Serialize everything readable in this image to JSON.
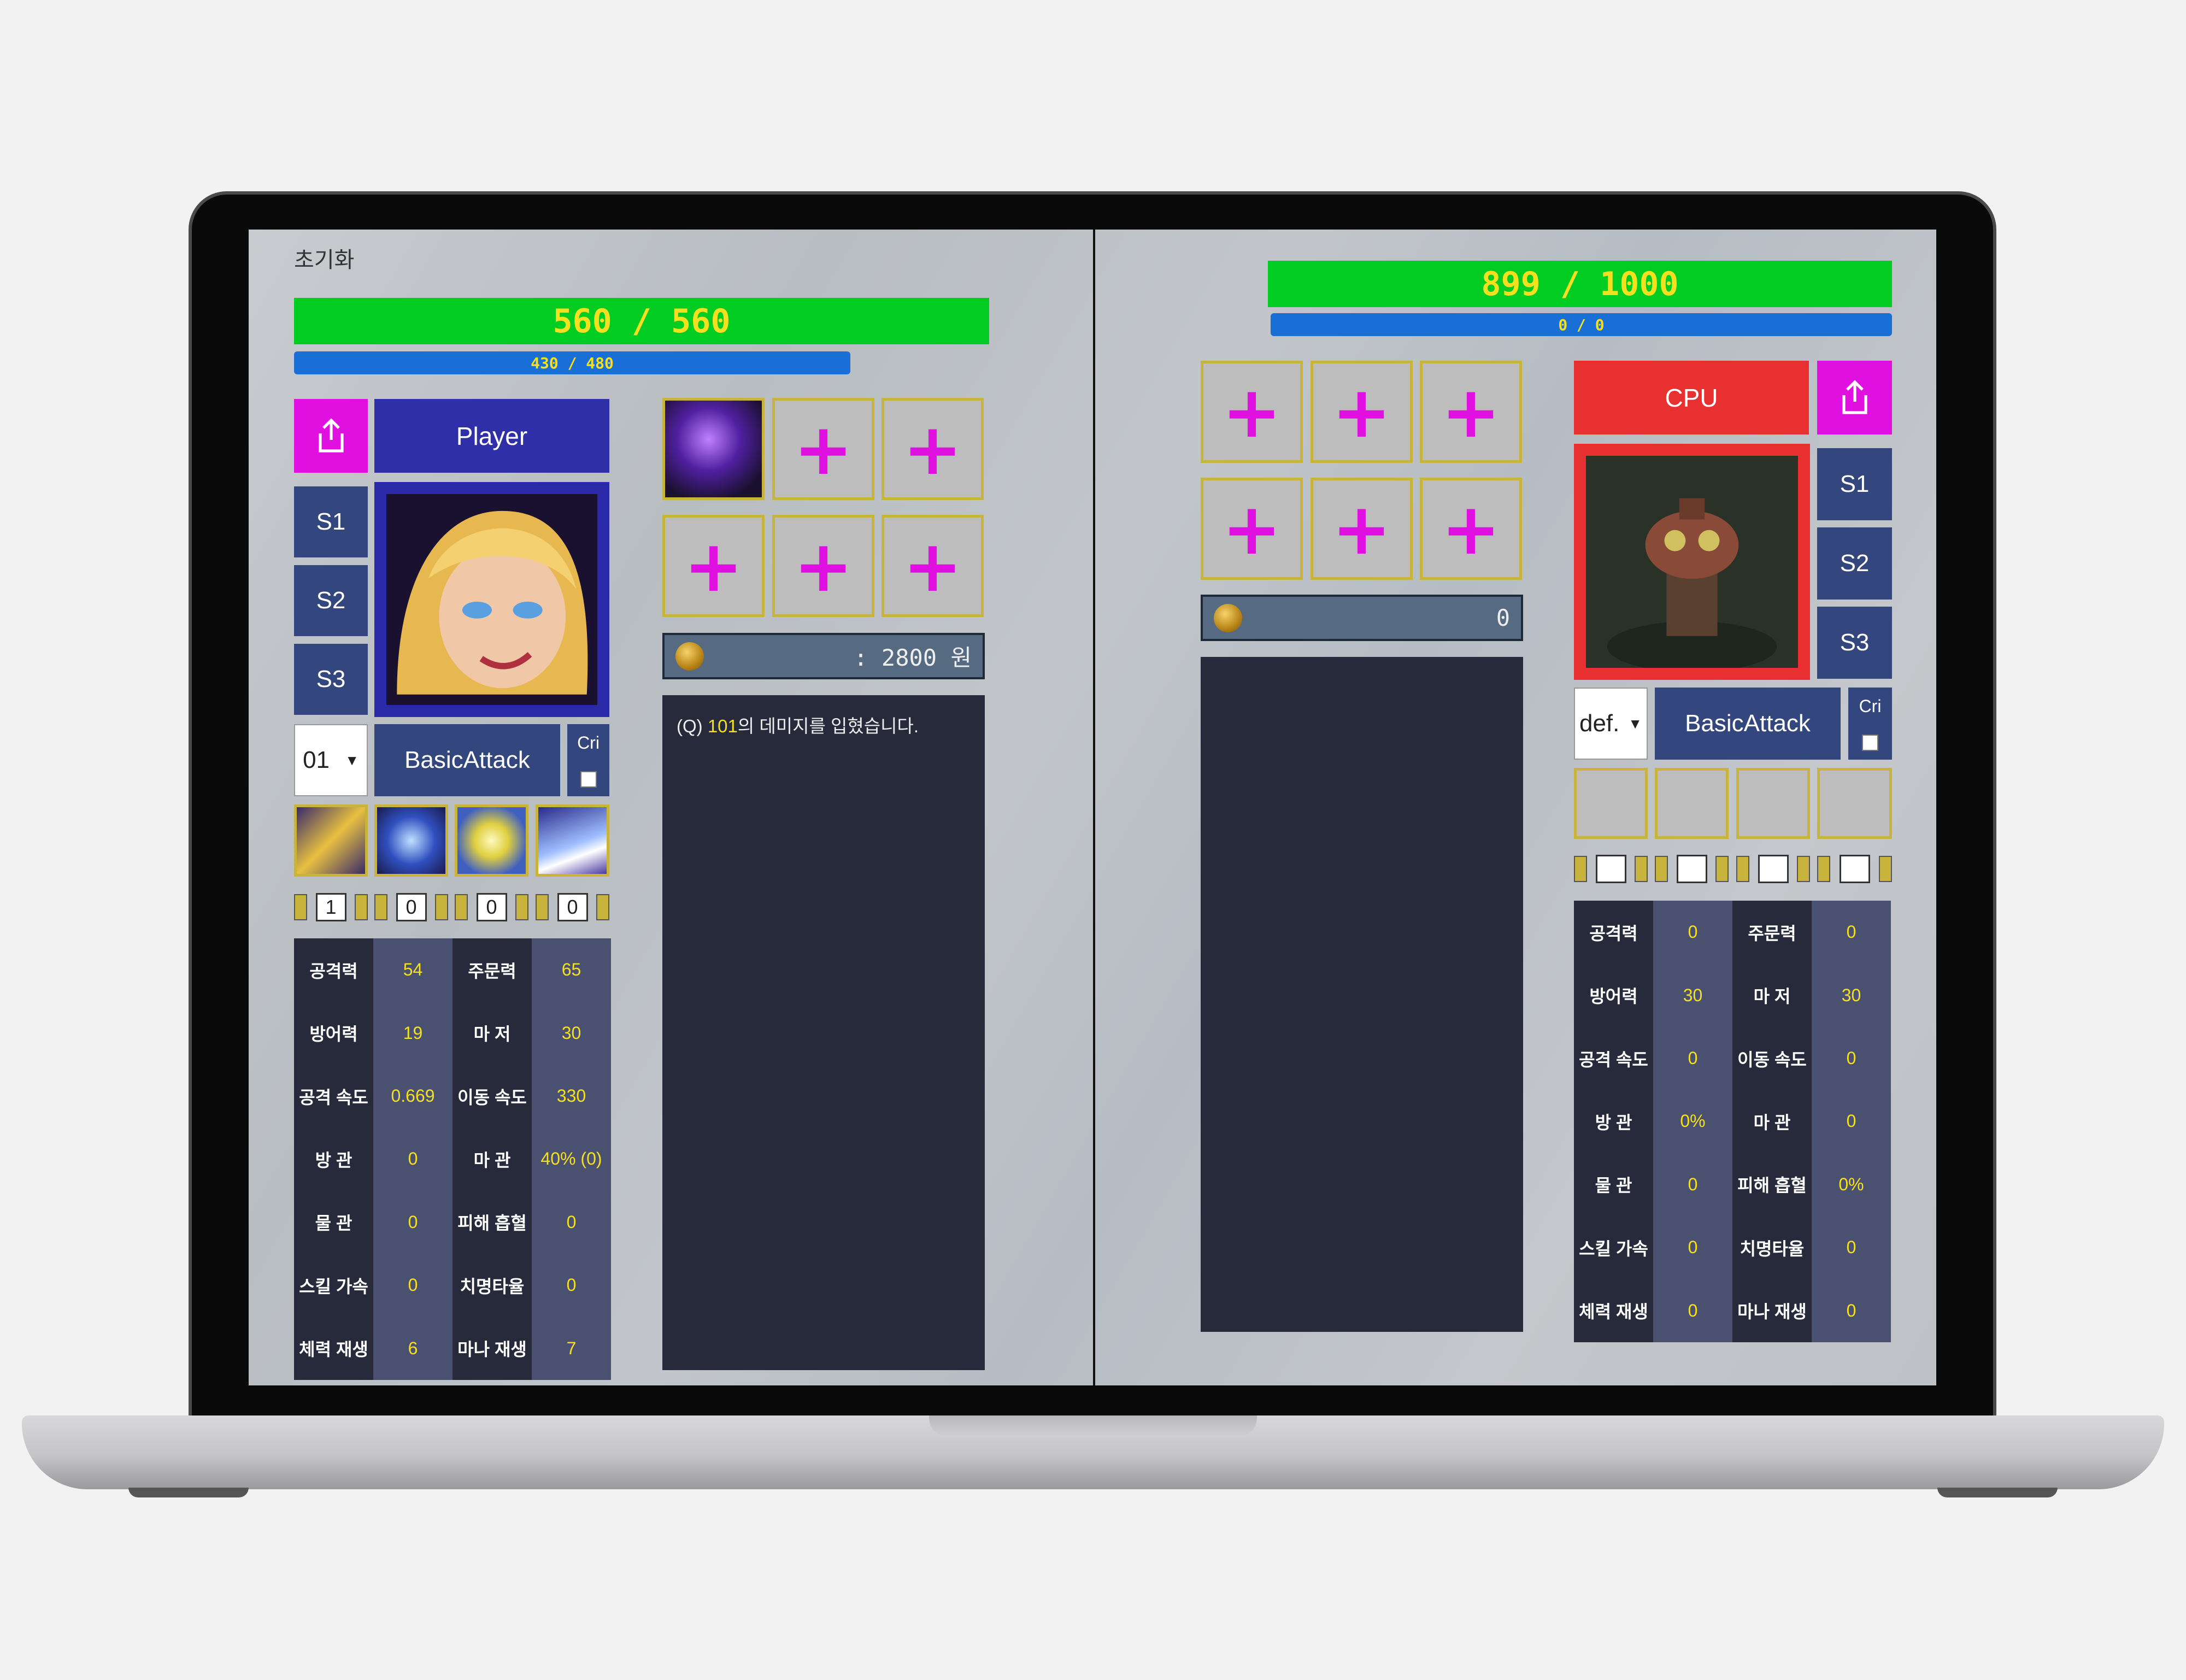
{
  "left": {
    "reset_label": "초기화",
    "hp": "560 / 560",
    "mp": "430 / 480",
    "name": "Player",
    "summoner_slots": [
      "S1",
      "S2",
      "S3"
    ],
    "level_select": "01",
    "attack_label": "BasicAttack",
    "cri_label": "Cri",
    "skill_levels": [
      "1",
      "0",
      "0",
      "0"
    ],
    "gold": ": 2800 원",
    "log": {
      "prefix": "(Q) ",
      "damage": "101",
      "suffix": "의 데미지를 입혔습니다."
    },
    "stats": [
      [
        "공격력",
        "54",
        "주문력",
        "65"
      ],
      [
        "방어력",
        "19",
        "마 저",
        "30"
      ],
      [
        "공격 속도",
        "0.669",
        "이동 속도",
        "330"
      ],
      [
        "방 관",
        "0",
        "마 관",
        "40% (0)"
      ],
      [
        "물 관",
        "0",
        "피해 흡혈",
        "0"
      ],
      [
        "스킬 가속",
        "0",
        "치명타율",
        "0"
      ],
      [
        "체력 재생",
        "6",
        "마나 재생",
        "7"
      ]
    ]
  },
  "right": {
    "hp": "899 / 1000",
    "mp": "0 / 0",
    "name": "CPU",
    "summoner_slots": [
      "S1",
      "S2",
      "S3"
    ],
    "level_select": "def.",
    "attack_label": "BasicAttack",
    "cri_label": "Cri",
    "gold": "0",
    "stats": [
      [
        "공격력",
        "0",
        "주문력",
        "0"
      ],
      [
        "방어력",
        "30",
        "마 저",
        "30"
      ],
      [
        "공격 속도",
        "0",
        "이동 속도",
        "0"
      ],
      [
        "방 관",
        "0%",
        "마 관",
        "0"
      ],
      [
        "물 관",
        "0",
        "피해 흡혈",
        "0%"
      ],
      [
        "스킬 가속",
        "0",
        "치명타율",
        "0"
      ],
      [
        "체력 재생",
        "0",
        "마나 재생",
        "0"
      ]
    ]
  },
  "icons": {
    "share": "share-icon",
    "add": "+",
    "coin": "coin-icon",
    "champion_left": "champion-portrait-blonde",
    "champion_right": "champion-portrait-robot"
  },
  "colors": {
    "hp": "#00cc22",
    "mp": "#1a6fd6",
    "text_accent": "#f5e020",
    "player_button": "#2f2fa8",
    "cpu_button": "#e83030",
    "share_button": "#e010e0",
    "slot_border": "#c8b43c"
  }
}
